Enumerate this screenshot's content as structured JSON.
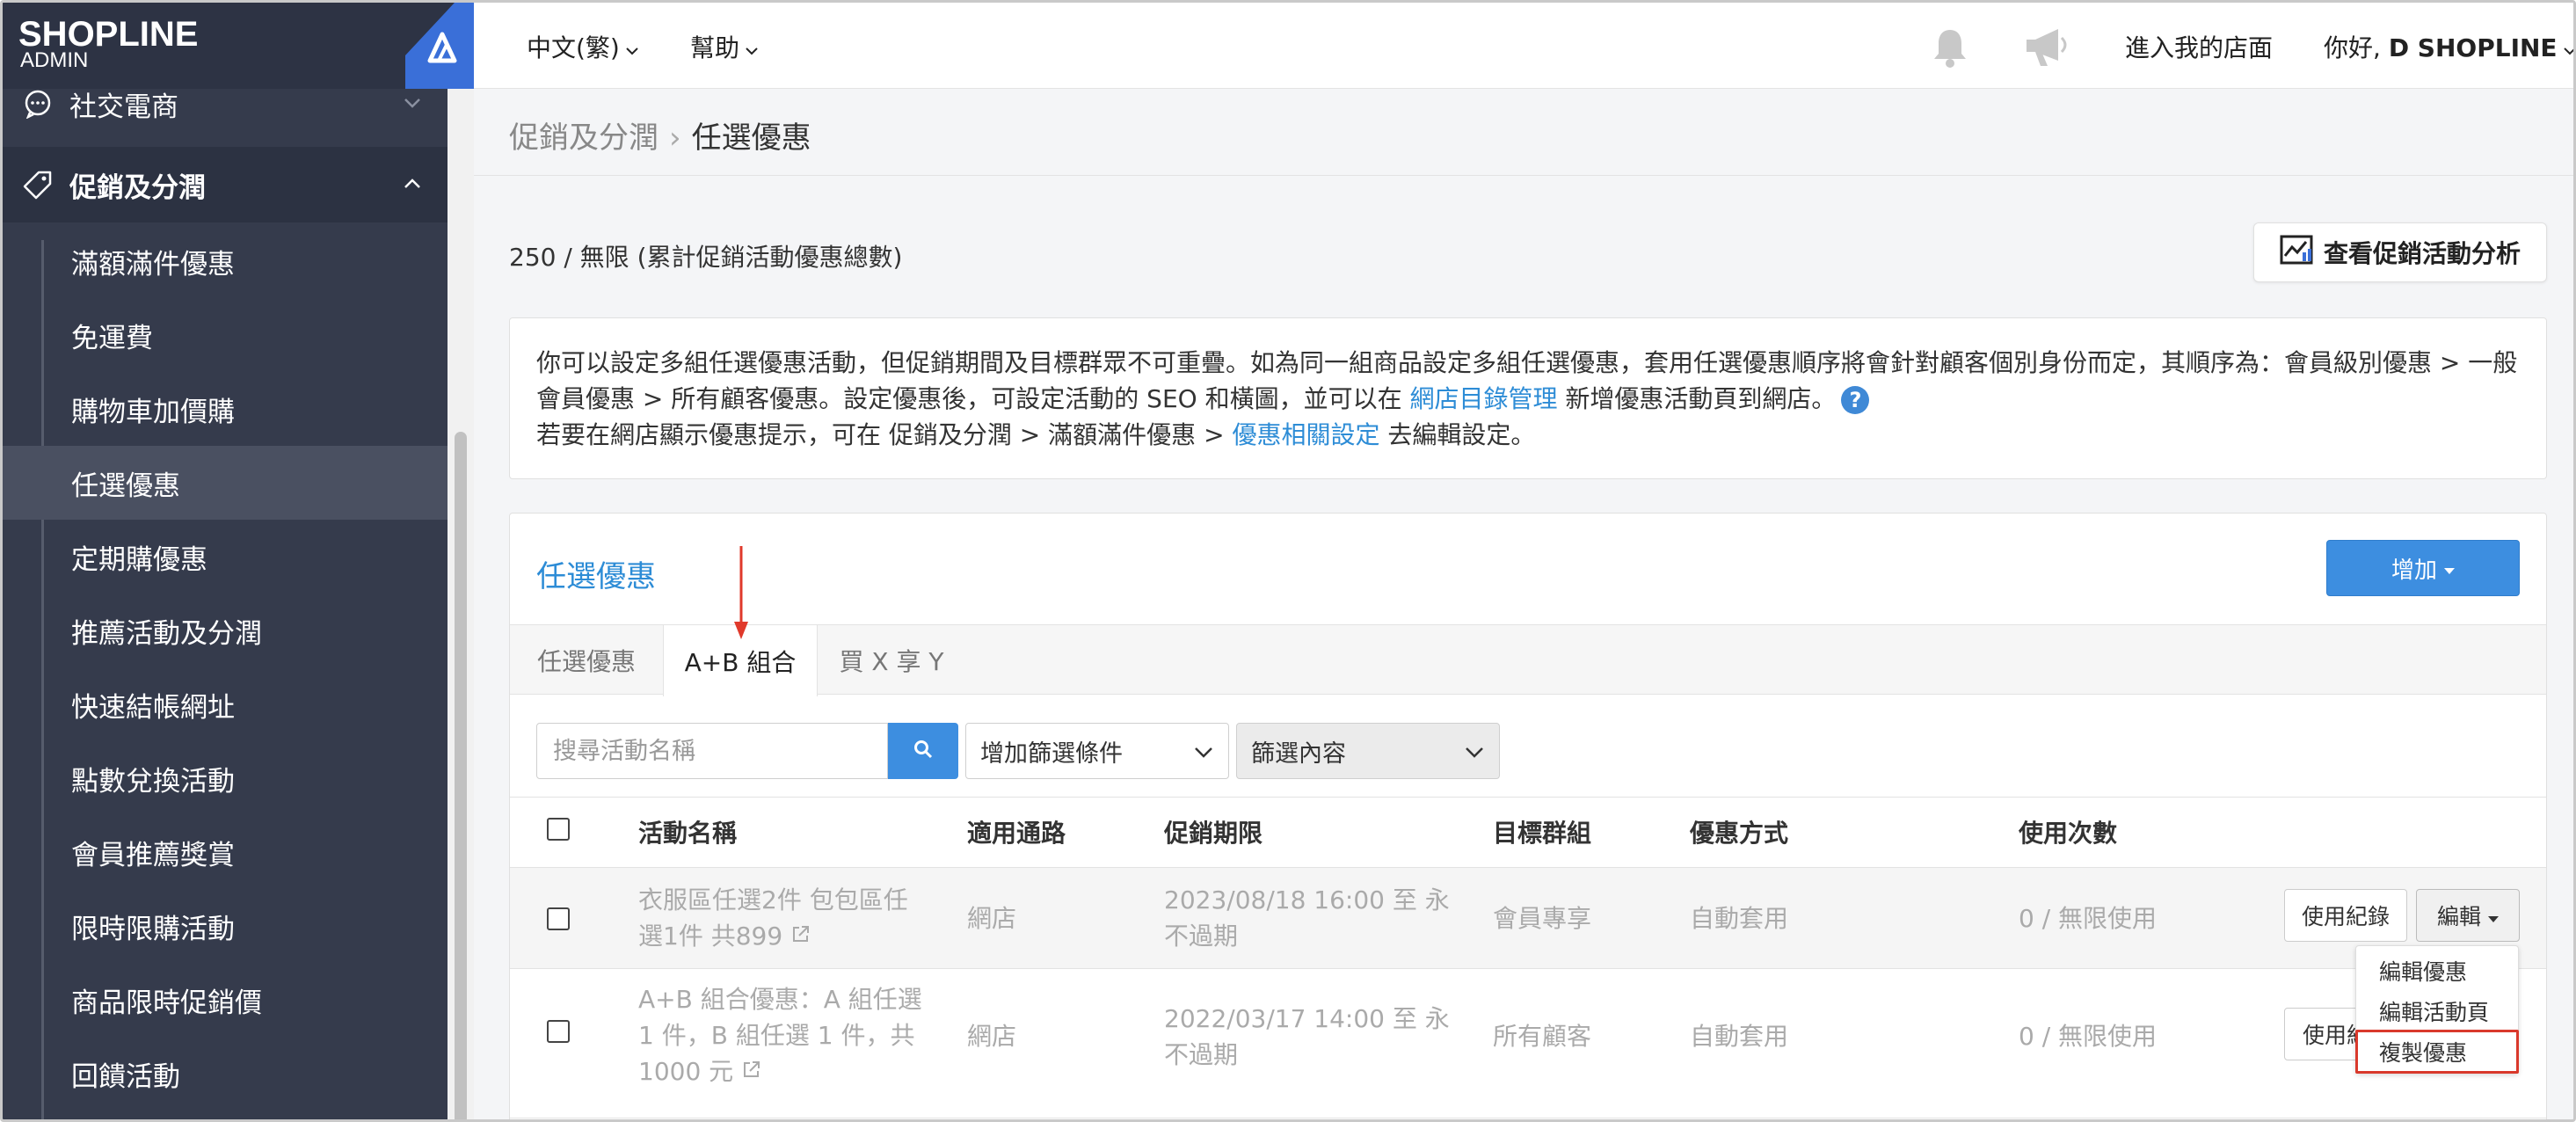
{
  "brand": {
    "logo": "SHOPLINE",
    "sub": "ADMIN"
  },
  "sidebar": {
    "groups": [
      {
        "label": "社交電商",
        "icon": "chat-bubble-icon"
      },
      {
        "label": "促銷及分潤",
        "icon": "tag-icon"
      }
    ],
    "items": [
      {
        "label": "滿額滿件優惠"
      },
      {
        "label": "免運費"
      },
      {
        "label": "購物車加價購"
      },
      {
        "label": "任選優惠"
      },
      {
        "label": "定期購優惠"
      },
      {
        "label": "推薦活動及分潤"
      },
      {
        "label": "快速結帳網址"
      },
      {
        "label": "點數兌換活動"
      },
      {
        "label": "會員推薦獎賞"
      },
      {
        "label": "限時限購活動"
      },
      {
        "label": "商品限時促銷價"
      },
      {
        "label": "回饋活動"
      }
    ]
  },
  "header": {
    "language": "中文(繁)",
    "help": "幫助",
    "store_link": "進入我的店面",
    "greeting_prefix": "你好, ",
    "user_name": "D SHOPLINE"
  },
  "breadcrumb": {
    "parent": "促銷及分潤",
    "current": "任選優惠"
  },
  "quota_text": "250 / 無限 (累計促銷活動優惠總數)",
  "analysis_button": "查看促銷活動分析",
  "notice": {
    "p1": "你可以設定多組任選優惠活動，但促銷期間及目標群眾不可重疊。如為同一組商品設定多組任選優惠，套用任選優惠順序將會針對顧客個別身份而定，其順序為：會員級別優惠 > 一般會員優惠 > 所有顧客優惠。設定優惠後，可設定活動的 SEO 和橫圖，並可以在 ",
    "link1": "網店目錄管理",
    "p1_end": " 新增優惠活動頁到網店。",
    "p2": "若要在網店顯示優惠提示，可在 促銷及分潤 > 滿額滿件優惠 > ",
    "link2": "優惠相關設定",
    "p2_end": " 去編輯設定。",
    "help_icon": "?"
  },
  "panel": {
    "title": "任選優惠",
    "add_button": "增加",
    "tabs": [
      "任選優惠",
      "A+B 組合",
      "買 X 享 Y"
    ],
    "active_tab": 1,
    "search_placeholder": "搜尋活動名稱",
    "filter_select": "增加篩選條件",
    "filter_content": "篩選內容",
    "columns": [
      "活動名稱",
      "適用通路",
      "促銷期限",
      "目標群組",
      "優惠方式",
      "使用次數"
    ],
    "rows": [
      {
        "name_l1": "衣服區任選2件 包包區任",
        "name_l2": "選1件 共899",
        "channel": "網店",
        "period_l1": "2023/08/18 16:00 至 永",
        "period_l2": "不過期",
        "group": "會員專享",
        "method": "自動套用",
        "usage": "0 / 無限使用"
      },
      {
        "name_l1": "A+B 組合優惠：A 組任選",
        "name_l2": "1 件，B 組任選 1 件，共",
        "name_l3": "1000 元",
        "channel": "網店",
        "period_l1": "2022/03/17 14:00 至 永",
        "period_l2": "不過期",
        "group": "所有顧客",
        "method": "自動套用",
        "usage": "0 / 無限使用"
      }
    ],
    "usage_button": "使用紀錄",
    "usage_button_clipped": "使用紀",
    "edit_button": "編輯",
    "dropdown": [
      "編輯優惠",
      "編輯活動頁",
      "複製優惠"
    ]
  }
}
